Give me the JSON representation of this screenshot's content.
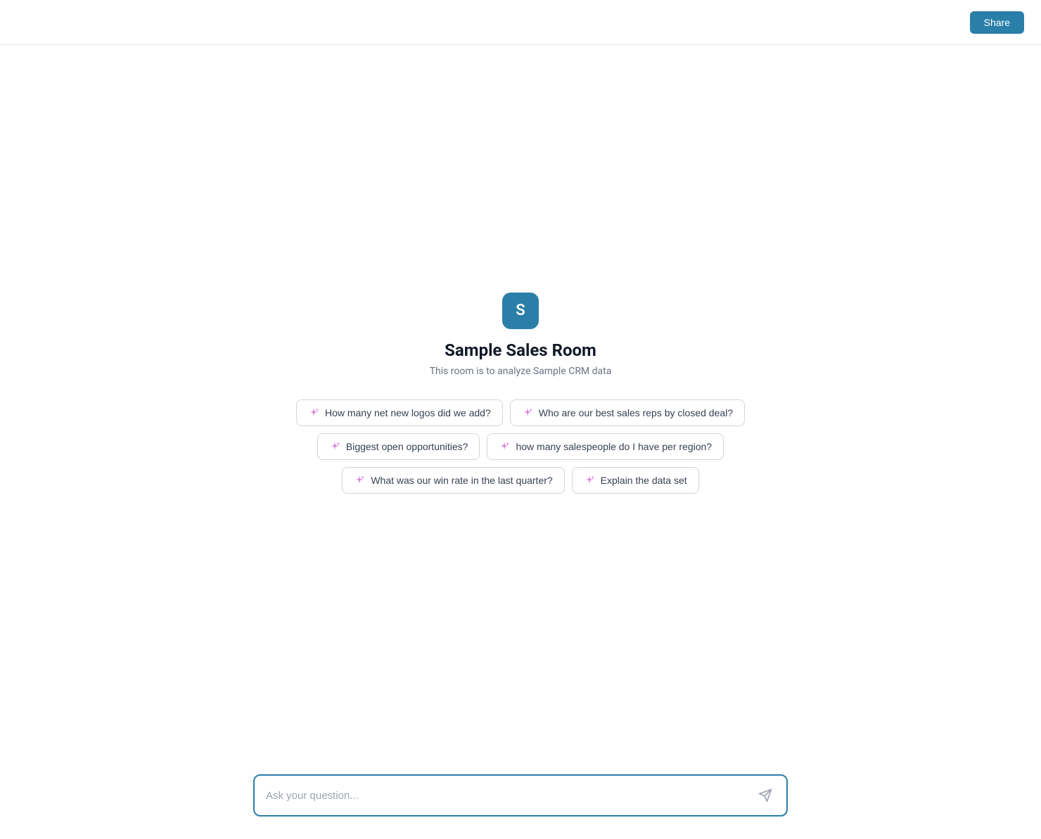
{
  "header": {
    "share_label": "Share"
  },
  "room": {
    "icon_letter": "S",
    "title": "Sample Sales Room",
    "subtitle": "This room is to analyze Sample CRM data"
  },
  "suggestions": {
    "rows": [
      [
        {
          "id": "chip-1",
          "label": "How many net new logos did we add?"
        },
        {
          "id": "chip-2",
          "label": "Who are our best sales reps by closed deal?"
        }
      ],
      [
        {
          "id": "chip-3",
          "label": "Biggest open opportunities?"
        },
        {
          "id": "chip-4",
          "label": "how many salespeople do I have per region?"
        }
      ],
      [
        {
          "id": "chip-5",
          "label": "What was our win rate in the last quarter?"
        },
        {
          "id": "chip-6",
          "label": "Explain the data set"
        }
      ]
    ]
  },
  "input": {
    "placeholder": "Ask your question..."
  },
  "colors": {
    "accent": "#2a7fa8",
    "sparkle_gradient_start": "#c084fc",
    "sparkle_gradient_end": "#f472b6"
  }
}
